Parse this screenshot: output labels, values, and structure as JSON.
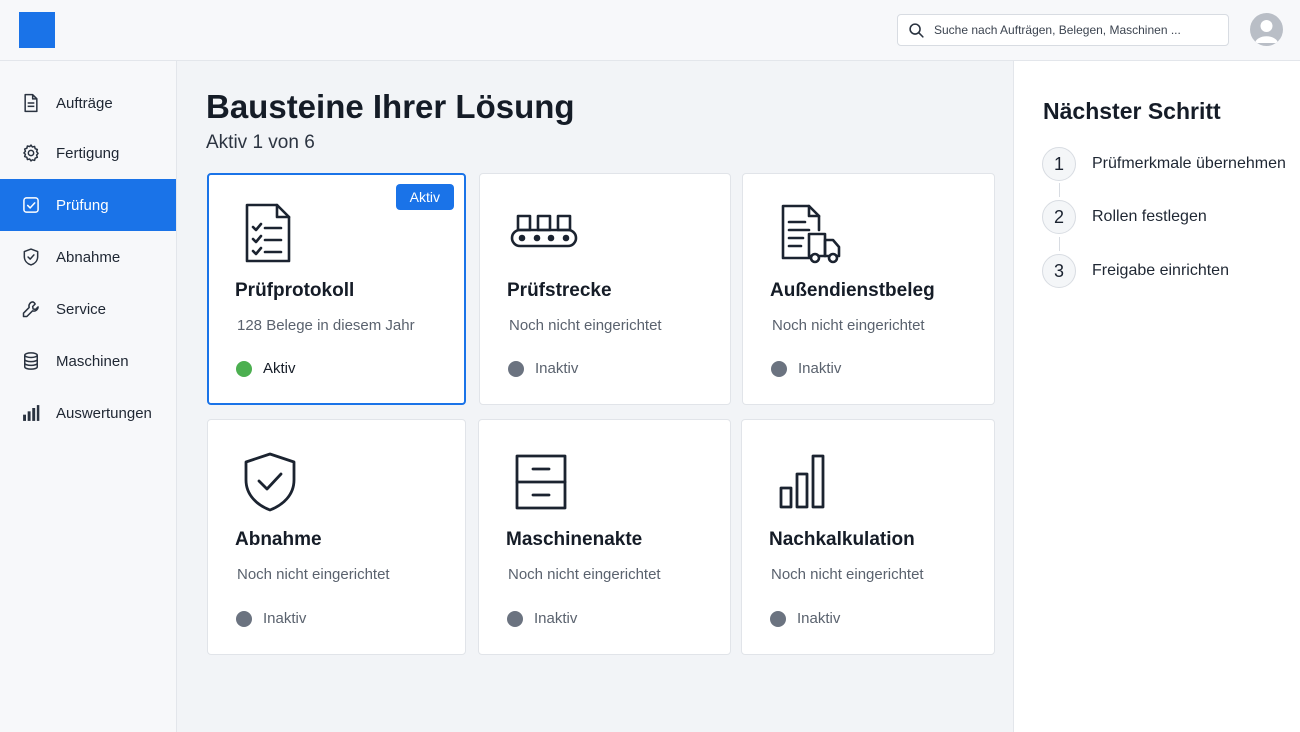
{
  "search": {
    "placeholder": "Suche nach Aufträgen, Belegen, Maschinen ..."
  },
  "sidebar": {
    "items": [
      {
        "label": "Aufträge",
        "icon": "document-icon"
      },
      {
        "label": "Fertigung",
        "icon": "gear-icon"
      },
      {
        "label": "Prüfung",
        "icon": "checkbox-icon",
        "active": true
      },
      {
        "label": "Abnahme",
        "icon": "shield-icon"
      },
      {
        "label": "Service",
        "icon": "wrench-icon"
      },
      {
        "label": "Maschinen",
        "icon": "database-icon"
      },
      {
        "label": "Auswertungen",
        "icon": "bar-chart-icon"
      }
    ]
  },
  "main": {
    "title": "Bausteine Ihrer Lösung",
    "subtitle": "Aktiv 1 von 6",
    "cards": [
      {
        "title": "Prüfprotokoll",
        "desc": "128 Belege in diesem Jahr",
        "status": "Aktiv",
        "badge": "Aktiv",
        "icon": "checklist-document-icon"
      },
      {
        "title": "Prüfstrecke",
        "desc": "Noch nicht eingerichtet",
        "status": "Inaktiv",
        "icon": "conveyor-icon"
      },
      {
        "title": "Außendienstbeleg",
        "desc": "Noch nicht eingerichtet",
        "status": "Inaktiv",
        "icon": "document-truck-icon"
      },
      {
        "title": "Abnahme",
        "desc": "Noch nicht eingerichtet",
        "status": "Inaktiv",
        "icon": "shield-check-icon"
      },
      {
        "title": "Maschinenakte",
        "desc": "Noch nicht eingerichtet",
        "status": "Inaktiv",
        "icon": "file-cabinet-icon"
      },
      {
        "title": "Nachkalkulation",
        "desc": "Noch nicht eingerichtet",
        "status": "Inaktiv",
        "icon": "bar-chart-icon"
      }
    ]
  },
  "next_step": {
    "title": "Nächster Schritt",
    "steps": [
      {
        "num": "1",
        "label": "Prüfmerkmale übernehmen"
      },
      {
        "num": "2",
        "label": "Rollen festlegen"
      },
      {
        "num": "3",
        "label": "Freigabe einrichten"
      }
    ]
  },
  "colors": {
    "accent": "#1a73e8",
    "active_dot": "#4caf50",
    "inactive_dot": "#6b7380"
  }
}
